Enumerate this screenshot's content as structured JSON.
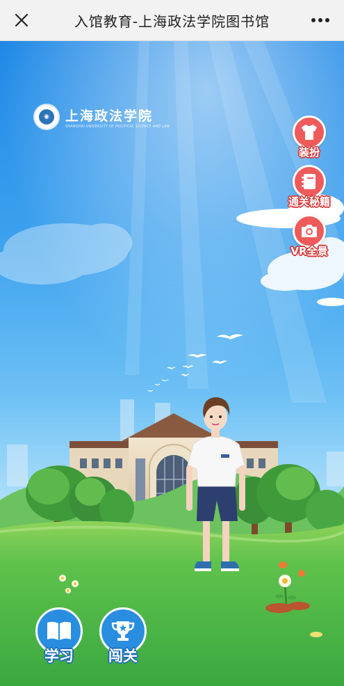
{
  "navbar": {
    "title": "入馆教育-上海政法学院图书馆",
    "close_icon": "close-icon",
    "more_icon": "more-dots-icon"
  },
  "logo": {
    "name_cn": "上海政法学院",
    "name_en": "SHANGHAI UNIVERSITY OF POLITICAL SCIENCE AND LAW",
    "emblem_icon": "university-seal-icon"
  },
  "side_actions": [
    {
      "label": "装扮",
      "icon": "tshirt-icon"
    },
    {
      "label": "通关秘籍",
      "icon": "notebook-icon"
    },
    {
      "label": "VR全景",
      "icon": "camera-icon"
    }
  ],
  "bottom_actions": [
    {
      "label": "学习",
      "icon": "open-book-icon"
    },
    {
      "label": "闯关",
      "icon": "trophy-icon"
    }
  ],
  "colors": {
    "sky_top": "#1f88e6",
    "grass": "#4cbc4a",
    "side_button": "#ef5a5a",
    "bottom_button": "#2a8ee0"
  }
}
